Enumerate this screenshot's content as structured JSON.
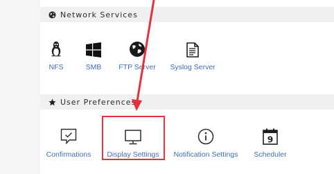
{
  "sections": {
    "network_services": {
      "title": "Network Services",
      "icon": "globe-icon",
      "items": [
        {
          "label": "NFS",
          "icon": "linux-tux-icon"
        },
        {
          "label": "SMB",
          "icon": "windows-icon"
        },
        {
          "label": "FTP Server",
          "icon": "ftp-globe-icon"
        },
        {
          "label": "Syslog Server",
          "icon": "document-icon"
        }
      ]
    },
    "user_preferences": {
      "title": "User Preferences",
      "icon": "star-icon",
      "items": [
        {
          "label": "Confirmations",
          "icon": "confirmation-speech-bubble-icon"
        },
        {
          "label": "Display Settings",
          "icon": "monitor-icon",
          "highlighted": true
        },
        {
          "label": "Notification Settings",
          "icon": "info-circle-icon"
        },
        {
          "label": "Scheduler",
          "icon": "calendar-icon",
          "glyph": "9"
        }
      ]
    }
  },
  "colors": {
    "header_bg": "#eef0f2",
    "link": "#3f6fb0",
    "highlight_arrow": "#e8303a"
  }
}
